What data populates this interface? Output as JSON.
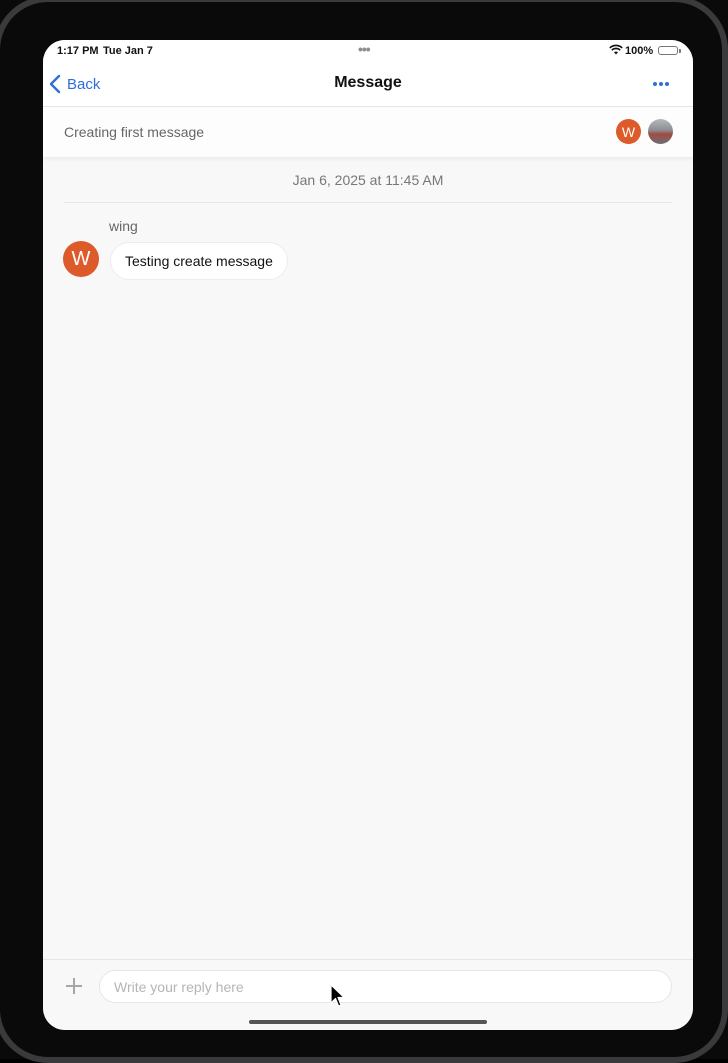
{
  "status_bar": {
    "time": "1:17 PM",
    "date": "Tue Jan 7",
    "multitask_dots": "•••",
    "battery": "100%"
  },
  "nav": {
    "back_label": "Back",
    "title": "Message",
    "more_icon": "ellipsis-icon"
  },
  "subject": {
    "text": "Creating first message",
    "participants": [
      {
        "initial": "W",
        "color": "#dd5a2a"
      },
      {
        "type": "photo"
      }
    ]
  },
  "thread": {
    "date_separator": "Jan 6, 2025 at 11:45 AM",
    "messages": [
      {
        "sender": "wing",
        "avatar_initial": "W",
        "avatar_color": "#dd5a2a",
        "text": "Testing create message"
      }
    ]
  },
  "composer": {
    "add_icon": "plus-icon",
    "placeholder": "Write your reply here",
    "value": ""
  },
  "colors": {
    "accent": "#2f6fd6",
    "avatar": "#dd5a2a",
    "background": "#f8f8f9"
  }
}
